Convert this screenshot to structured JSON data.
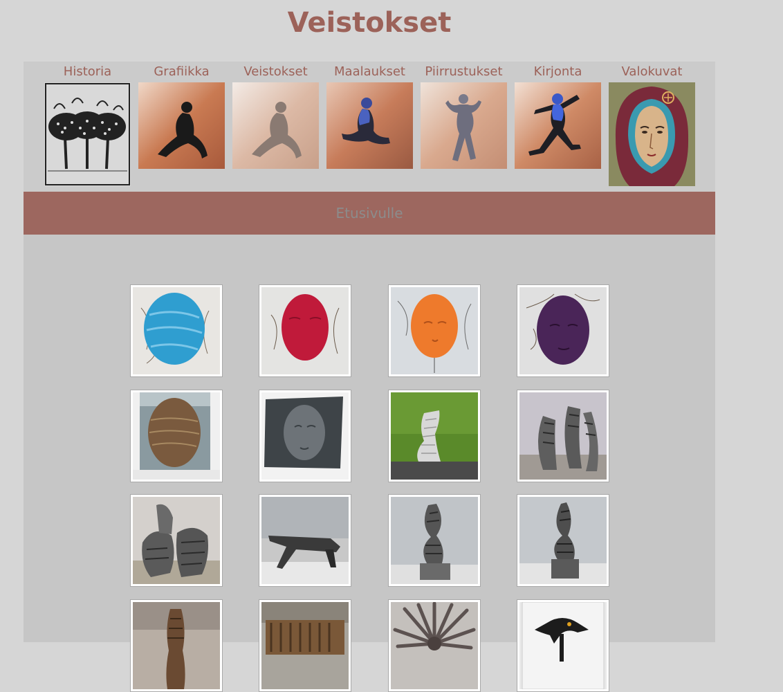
{
  "page": {
    "title": "Veistokset"
  },
  "nav": {
    "items": [
      {
        "label": "Historia"
      },
      {
        "label": "Grafiikka"
      },
      {
        "label": "Veistokset"
      },
      {
        "label": "Maalaukset"
      },
      {
        "label": "Piirrustukset"
      },
      {
        "label": "Kirjonta"
      },
      {
        "label": "Valokuvat"
      }
    ]
  },
  "home_link": {
    "label": "Etusivulle"
  },
  "gallery": {
    "items": [
      {
        "subject": "blue-mask",
        "color": "#2f9ed0"
      },
      {
        "subject": "red-mask",
        "color": "#c01a3a"
      },
      {
        "subject": "orange-mask",
        "color": "#ee7a2c"
      },
      {
        "subject": "purple-mask",
        "color": "#4a2558"
      },
      {
        "subject": "wooden-mask",
        "color": "#7a5a3e"
      },
      {
        "subject": "stone-face-relief",
        "color": "#6d7378"
      },
      {
        "subject": "stone-tower-on-grass",
        "color": "#d8d8d8"
      },
      {
        "subject": "stone-pair",
        "color": "#5e5e5e"
      },
      {
        "subject": "stone-pair-tilted",
        "color": "#5a5a5a"
      },
      {
        "subject": "dark-bench",
        "color": "#3a3a3a"
      },
      {
        "subject": "stone-spire",
        "color": "#555555"
      },
      {
        "subject": "stone-spire-on-base",
        "color": "#4e4e4e"
      },
      {
        "subject": "tall-figure",
        "color": "#6a4a32"
      },
      {
        "subject": "rusty-relief",
        "color": "#7a5838"
      },
      {
        "subject": "starburst",
        "color": "#5c5250"
      },
      {
        "subject": "black-bird-sculpture",
        "color": "#1c1c1c"
      }
    ]
  }
}
